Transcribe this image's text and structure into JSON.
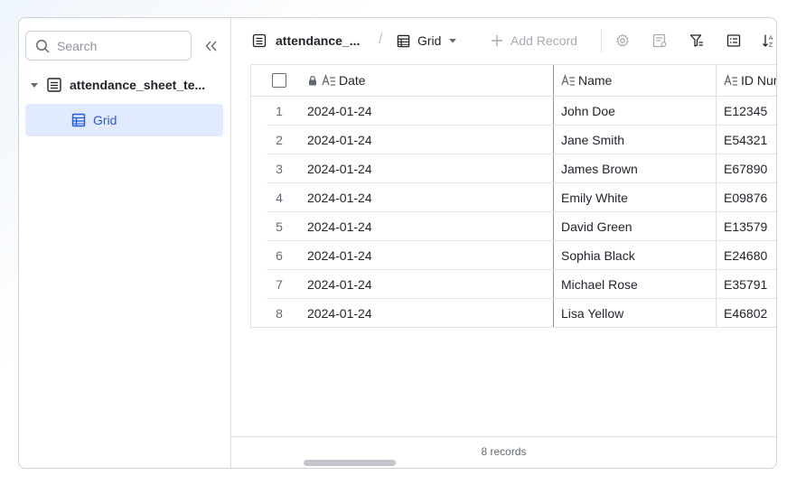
{
  "sidebar": {
    "search_placeholder": "Search",
    "table_name": "attendance_sheet_te...",
    "view_name": "Grid"
  },
  "toolbar": {
    "table_name": "attendance_...",
    "separator": "/",
    "view_name": "Grid",
    "add_record_label": "Add Record",
    "icons": [
      "settings-icon",
      "form-icon",
      "filter-icon",
      "group-icon",
      "sort-icon"
    ]
  },
  "grid": {
    "columns": [
      "Date",
      "Name",
      "ID Num"
    ],
    "rows": [
      {
        "index": "1",
        "date": "2024-01-24",
        "name": "John Doe",
        "id": "E12345"
      },
      {
        "index": "2",
        "date": "2024-01-24",
        "name": "Jane Smith",
        "id": "E54321"
      },
      {
        "index": "3",
        "date": "2024-01-24",
        "name": "James Brown",
        "id": "E67890"
      },
      {
        "index": "4",
        "date": "2024-01-24",
        "name": "Emily White",
        "id": "E09876"
      },
      {
        "index": "5",
        "date": "2024-01-24",
        "name": "David Green",
        "id": "E13579"
      },
      {
        "index": "6",
        "date": "2024-01-24",
        "name": "Sophia Black",
        "id": "E24680"
      },
      {
        "index": "7",
        "date": "2024-01-24",
        "name": "Michael Rose",
        "id": "E35791"
      },
      {
        "index": "8",
        "date": "2024-01-24",
        "name": "Lisa Yellow",
        "id": "E46802"
      }
    ]
  },
  "footer": {
    "record_count": "8 records"
  },
  "colors": {
    "accent": "#245bdb",
    "selected_bg": "#e1eaff",
    "border": "#dee0e3",
    "muted": "#8f959e"
  }
}
